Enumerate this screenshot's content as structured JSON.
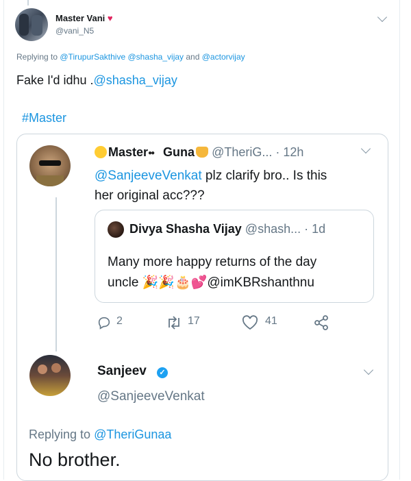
{
  "outer_tweet": {
    "author_name": "Master Vani",
    "heart_emoji": "♥",
    "author_handle": "@vani_N5",
    "replying_prefix": "Replying to ",
    "replying_handles": "@TirupurSakthive @shasha_vijay",
    "replying_and": " and ",
    "replying_last": "@actorvijay",
    "text_plain": "Fake I'd idhu .",
    "text_mention": "@shasha_vijay",
    "hashtag": "#Master"
  },
  "quoted_tweet": {
    "author_name": "Master",
    "author_name_suffix": "Guna",
    "author_handle": "@TheriG...",
    "time": " · 12h",
    "text_mention": "@SanjeeveVenkat",
    "text_line1": " plz clarify bro.. Is this",
    "text_line2": "her original acc???",
    "inner_quote": {
      "author_name": "Divya Shasha Vijay",
      "author_handle": "@shash...",
      "time": " · 1d",
      "text_line1": "Many more happy returns of the day",
      "text_line2_plain": "uncle ",
      "emojis": "🎉🎉🎂💕",
      "text_line2_mention": "@imKBRshanthnu"
    },
    "actions": {
      "replies": "2",
      "retweets": "17",
      "likes": "41"
    }
  },
  "reply": {
    "author_name": "Sanjeev",
    "verified_mark": "✓",
    "author_handle": "@SanjeeveVenkat",
    "replying_prefix": "Replying to ",
    "replying_handle": "@TheriGunaa",
    "text": "No brother."
  },
  "colors": {
    "link": "#1b95e0",
    "secondary_text": "#657786",
    "border": "#ccd6dd",
    "heart": "#e0245e",
    "verified": "#1da1f2"
  }
}
